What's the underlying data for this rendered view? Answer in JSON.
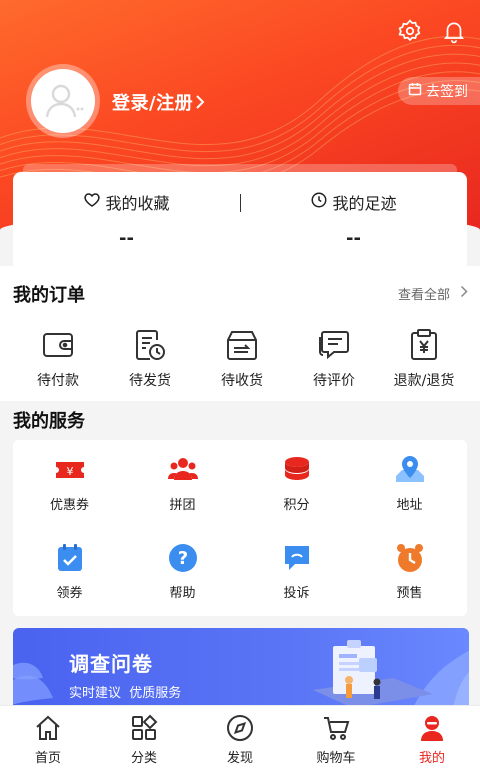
{
  "header": {
    "login_label": "登录/注册",
    "signin_label": "去签到"
  },
  "favorites": {
    "collect_label": "我的收藏",
    "collect_value": "--",
    "footprint_label": "我的足迹",
    "footprint_value": "--"
  },
  "orders": {
    "title": "我的订单",
    "see_all": "查看全部",
    "items": [
      {
        "label": "待付款",
        "icon": "wallet-icon"
      },
      {
        "label": "待发货",
        "icon": "pending-ship-icon"
      },
      {
        "label": "待收货",
        "icon": "receive-box-icon"
      },
      {
        "label": "待评价",
        "icon": "review-icon"
      },
      {
        "label": "退款/退货",
        "icon": "refund-icon"
      }
    ]
  },
  "services": {
    "title": "我的服务",
    "items": [
      {
        "label": "优惠券",
        "icon": "coupon-icon",
        "color": "#e8271f"
      },
      {
        "label": "拼团",
        "icon": "group-buy-icon",
        "color": "#e8271f"
      },
      {
        "label": "积分",
        "icon": "points-icon",
        "color": "#e8271f"
      },
      {
        "label": "地址",
        "icon": "location-icon",
        "color": "#3b8ef0"
      },
      {
        "label": "领券",
        "icon": "claim-coupon-icon",
        "color": "#3b8ef0"
      },
      {
        "label": "帮助",
        "icon": "help-icon",
        "color": "#3b8ef0"
      },
      {
        "label": "投诉",
        "icon": "complaint-icon",
        "color": "#3b8ef0"
      },
      {
        "label": "预售",
        "icon": "presale-clock-icon",
        "color": "#f07a2c"
      }
    ]
  },
  "banner": {
    "title": "调查问卷",
    "subtitle": "实时建议  优质服务"
  },
  "tabbar": {
    "items": [
      {
        "label": "首页",
        "icon": "home-icon"
      },
      {
        "label": "分类",
        "icon": "category-icon"
      },
      {
        "label": "发现",
        "icon": "compass-icon"
      },
      {
        "label": "购物车",
        "icon": "cart-icon"
      },
      {
        "label": "我的",
        "icon": "profile-icon",
        "active": true
      }
    ]
  },
  "colors": {
    "brand_red": "#e8271f",
    "header_orange": "#ff6a2c",
    "banner_blue": "#4a63f0"
  }
}
